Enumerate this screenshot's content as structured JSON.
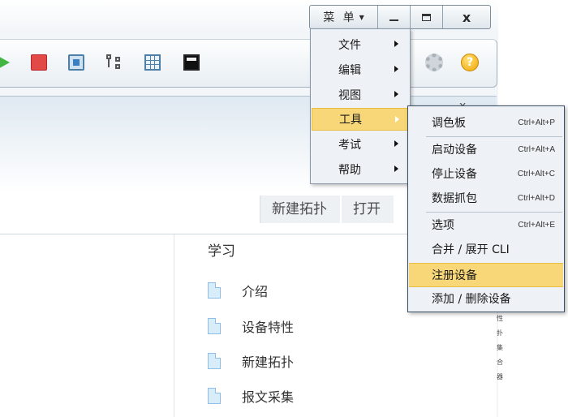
{
  "window": {
    "menu_label": "菜 单",
    "minimize": "_",
    "maximize": "□",
    "close": "x"
  },
  "toolbar": {
    "icons": [
      "play-icon",
      "stop-icon",
      "capture-icon",
      "topology-icon",
      "grid-icon",
      "terminal-icon",
      "gear-icon",
      "help-icon"
    ],
    "help_glyph": "?"
  },
  "banner": {
    "close": "x",
    "crumbs": [
      "新建拓扑",
      "打开"
    ]
  },
  "learn": {
    "title": "学习",
    "items": [
      "介绍",
      "设备特性",
      "新建拓扑",
      "报文采集"
    ]
  },
  "side_label": "性扑集合器",
  "main_menu": {
    "items": [
      {
        "label": "文件"
      },
      {
        "label": "编辑"
      },
      {
        "label": "视图"
      },
      {
        "label": "工具"
      },
      {
        "label": "考试"
      },
      {
        "label": "帮助"
      }
    ],
    "active_index": 3
  },
  "tools_submenu": {
    "items": [
      {
        "label": "调色板",
        "shortcut": "Ctrl+Alt+P"
      },
      {
        "label": "启动设备",
        "shortcut": "Ctrl+Alt+A"
      },
      {
        "label": "停止设备",
        "shortcut": "Ctrl+Alt+C"
      },
      {
        "label": "数据抓包",
        "shortcut": "Ctrl+Alt+D"
      },
      {
        "label": "选项",
        "shortcut": "Ctrl+Alt+E"
      },
      {
        "label": "合并 / 展开 CLI",
        "shortcut": ""
      },
      {
        "label": "注册设备",
        "shortcut": ""
      },
      {
        "label": "添加 / 删除设备",
        "shortcut": ""
      }
    ],
    "highlighted_index": 6
  },
  "colors": {
    "highlight": "#f7d778",
    "menu_bg": "#eef2f6",
    "accent_blue": "#4d7fa8"
  }
}
